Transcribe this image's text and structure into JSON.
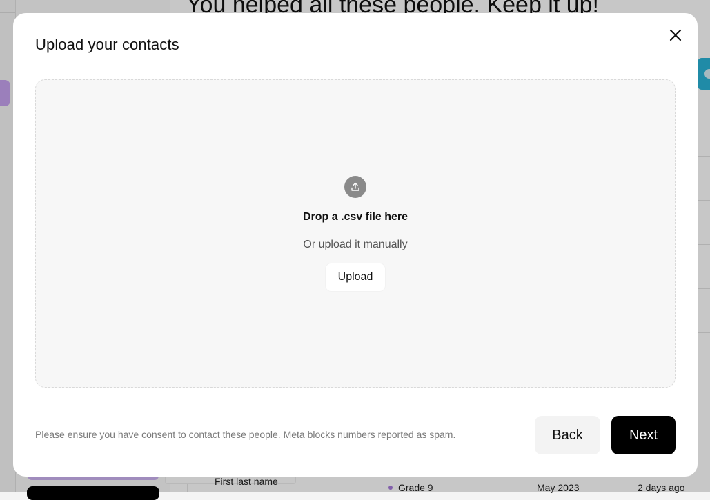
{
  "background": {
    "page_heading": "You helped all these people. Keep it up!",
    "row": {
      "name": "First last name",
      "grade": "Grade 9",
      "date": "May 2023",
      "ago": "2 days ago"
    }
  },
  "modal": {
    "title": "Upload your contacts",
    "close_icon": "close-icon",
    "dropzone": {
      "icon": "upload-icon",
      "title": "Drop a .csv file here",
      "subtitle": "Or upload it manually",
      "upload_label": "Upload"
    },
    "consent_text": "Please ensure you have consent to contact these people. Meta blocks numbers reported as spam.",
    "back_label": "Back",
    "next_label": "Next"
  },
  "colors": {
    "primary_button": "#000000",
    "secondary_button": "#f3f3f3",
    "dropzone_bg": "#f7f7f7",
    "accent_purple": "#c7a3f0",
    "accent_teal": "#2ab3d6"
  }
}
